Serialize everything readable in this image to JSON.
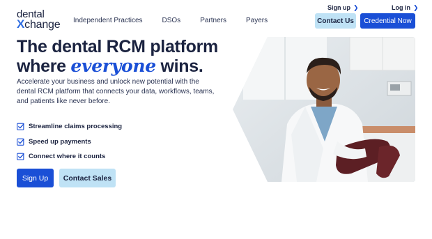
{
  "logo": {
    "line1": "dental",
    "x": "X",
    "line2": "change"
  },
  "nav": [
    {
      "label": "Independent Practices"
    },
    {
      "label": "DSOs"
    },
    {
      "label": "Partners"
    },
    {
      "label": "Payers"
    }
  ],
  "top_links": {
    "signup": "Sign up",
    "login": "Log in",
    "chevron": "❯"
  },
  "header_buttons": {
    "contact": "Contact Us",
    "credential": "Credential Now"
  },
  "hero": {
    "title_line1": "The dental RCM platform",
    "title_where": "where",
    "title_emph": "everyone",
    "title_end": "wins.",
    "description": "Accelerate your business and unlock new potential with the dental RCM platform that connects your data, workflows, teams, and patients like never before.",
    "features": [
      "Streamline claims processing",
      "Speed up payments",
      "Connect where it counts"
    ],
    "primary_cta": "Sign Up",
    "secondary_cta": "Contact Sales"
  },
  "colors": {
    "brand_blue": "#1a4fd6",
    "light_blue": "#bfe2f5",
    "navy": "#1b2340"
  }
}
